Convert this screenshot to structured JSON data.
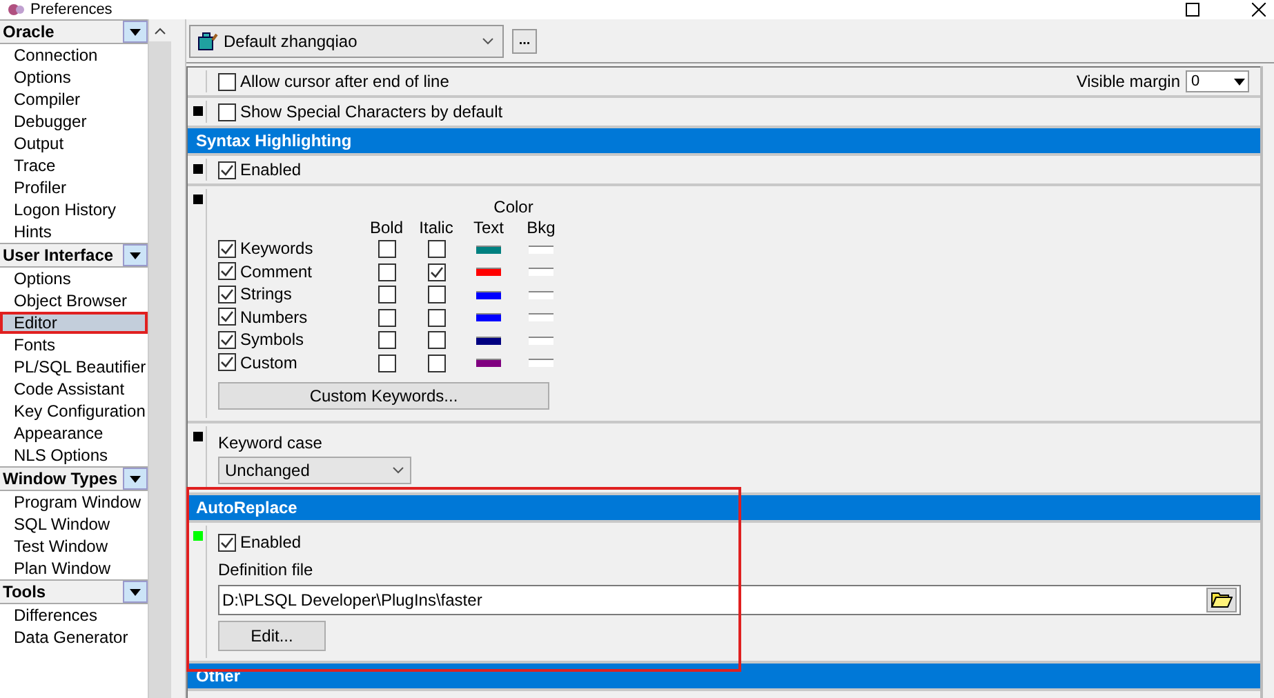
{
  "window": {
    "title": "Preferences"
  },
  "sidebar": {
    "groups": [
      {
        "title": "Oracle",
        "items": [
          {
            "label": "Connection",
            "selected": false
          },
          {
            "label": "Options",
            "selected": false
          },
          {
            "label": "Compiler",
            "selected": false
          },
          {
            "label": "Debugger",
            "selected": false
          },
          {
            "label": "Output",
            "selected": false
          },
          {
            "label": "Trace",
            "selected": false
          },
          {
            "label": "Profiler",
            "selected": false
          },
          {
            "label": "Logon History",
            "selected": false
          },
          {
            "label": "Hints",
            "selected": false
          }
        ]
      },
      {
        "title": "User Interface",
        "items": [
          {
            "label": "Options",
            "selected": false
          },
          {
            "label": "Object Browser",
            "selected": false
          },
          {
            "label": "Editor",
            "selected": true
          },
          {
            "label": "Fonts",
            "selected": false
          },
          {
            "label": "PL/SQL Beautifier",
            "selected": false
          },
          {
            "label": "Code Assistant",
            "selected": false
          },
          {
            "label": "Key Configuration",
            "selected": false
          },
          {
            "label": "Appearance",
            "selected": false
          },
          {
            "label": "NLS Options",
            "selected": false
          }
        ]
      },
      {
        "title": "Window Types",
        "items": [
          {
            "label": "Program Window",
            "selected": false
          },
          {
            "label": "SQL Window",
            "selected": false
          },
          {
            "label": "Test Window",
            "selected": false
          },
          {
            "label": "Plan Window",
            "selected": false
          }
        ]
      },
      {
        "title": "Tools",
        "items": [
          {
            "label": "Differences",
            "selected": false
          },
          {
            "label": "Data Generator",
            "selected": false
          }
        ]
      }
    ]
  },
  "profile": {
    "value": "Default zhangqiao",
    "more_button": "..."
  },
  "editor": {
    "rows": [
      {
        "kind": "check",
        "label": "Allow cursor after end of line",
        "checked": false,
        "margin": {
          "label": "Visible margin",
          "value": "0"
        }
      },
      {
        "kind": "check",
        "color": "#000000",
        "label": "Show Special Characters by default",
        "checked": false
      },
      {
        "kind": "header",
        "label": "Syntax Highlighting"
      },
      {
        "kind": "check",
        "color": "#000000",
        "label": "Enabled",
        "checked": true
      },
      {
        "kind": "syntax",
        "color": "#000000",
        "group_label": "Color",
        "columns": [
          "Bold",
          "Italic",
          "Text",
          "Bkg"
        ],
        "button": "Custom Keywords...",
        "items": [
          {
            "label": "Keywords",
            "checked": true,
            "bold": false,
            "italic": false,
            "color": "#008080"
          },
          {
            "label": "Comment",
            "checked": true,
            "bold": false,
            "italic": true,
            "color": "#ff0000"
          },
          {
            "label": "Strings",
            "checked": true,
            "bold": false,
            "italic": false,
            "color": "#0000ff"
          },
          {
            "label": "Numbers",
            "checked": true,
            "bold": false,
            "italic": false,
            "color": "#0000ff"
          },
          {
            "label": "Symbols",
            "checked": true,
            "bold": false,
            "italic": false,
            "color": "#000080"
          },
          {
            "label": "Custom",
            "checked": true,
            "bold": false,
            "italic": false,
            "color": "#800080"
          }
        ]
      },
      {
        "kind": "select",
        "color": "#000000",
        "label": "Keyword case",
        "value": "Unchanged"
      },
      {
        "kind": "header",
        "label": "AutoReplace"
      },
      {
        "kind": "file",
        "color": "#00ff00",
        "check_label": "Enabled",
        "checked": true,
        "label": "Definition file",
        "value": "D:\\PLSQL Developer\\PlugIns\\faster",
        "button": "Edit..."
      },
      {
        "kind": "header",
        "label": "Other"
      }
    ]
  }
}
